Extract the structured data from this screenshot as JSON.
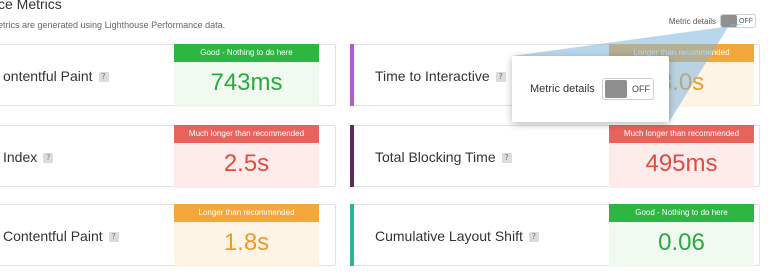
{
  "header": {
    "title": "ce Metrics",
    "subtitle": "etrics are generated using Lighthouse Performance data.",
    "metric_details_label": "Metric details",
    "toggle_state": "OFF"
  },
  "cards": [
    {
      "name": "ontentful Paint",
      "status": "Good - Nothing to do here",
      "value": "743ms",
      "level": "good"
    },
    {
      "name": "Time to Interactive",
      "status": "Longer than recommended",
      "value": "3.0s",
      "level": "warn"
    },
    {
      "name": "Index",
      "status": "Much longer than recommended",
      "value": "2.5s",
      "level": "poor"
    },
    {
      "name": "Total Blocking Time",
      "status": "Much longer than recommended",
      "value": "495ms",
      "level": "poor"
    },
    {
      "name": "Contentful Paint",
      "status": "Longer than recommended",
      "value": "1.8s",
      "level": "warn"
    },
    {
      "name": "Cumulative Layout Shift",
      "status": "Good - Nothing to do here",
      "value": "0.06",
      "level": "good"
    }
  ],
  "popover": {
    "label": "Metric details",
    "toggle_state": "OFF"
  },
  "colors": {
    "good": "#2db742",
    "poor": "#e8635b",
    "warn": "#f5a73a",
    "accent_purple": "#b05bd1",
    "accent_dark_purple": "#5b2a5e",
    "accent_teal": "#2bb39a"
  },
  "icons": {
    "help": "?"
  }
}
